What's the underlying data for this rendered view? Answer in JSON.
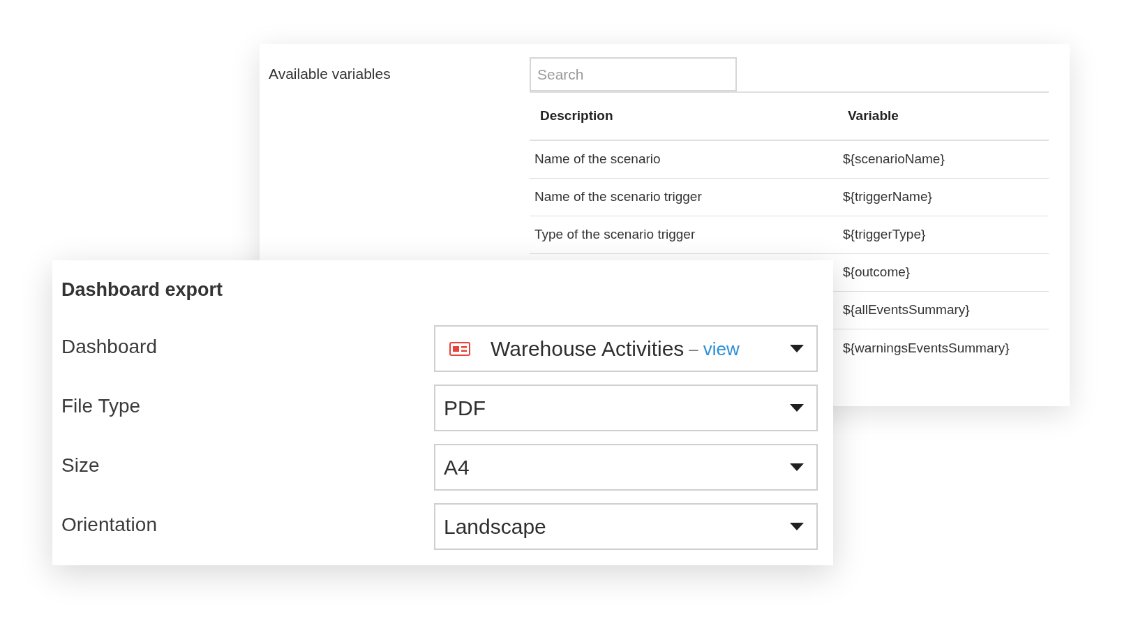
{
  "variables_panel": {
    "title": "Available variables",
    "search": {
      "placeholder": "Search"
    },
    "table": {
      "columns": [
        "Description",
        "Variable"
      ],
      "rows": [
        {
          "description": "Name of the scenario",
          "variable": "${scenarioName}"
        },
        {
          "description": "Name of the scenario trigger",
          "variable": "${triggerName}"
        },
        {
          "description": "Type of the scenario trigger",
          "variable": "${triggerType}"
        },
        {
          "variable": "${outcome}"
        },
        {
          "variable": "${allEventsSummary}"
        },
        {
          "variable": "${warningsEventsSummary}"
        }
      ]
    }
  },
  "dashboard_export": {
    "title": "Dashboard export",
    "fields": [
      {
        "kind": "dashboard",
        "label": "Dashboard",
        "value": "Warehouse Activities",
        "separator": "–",
        "link": "view"
      },
      {
        "kind": "select",
        "label": "File Type",
        "value": "PDF"
      },
      {
        "kind": "select",
        "label": "Size",
        "value": "A4"
      },
      {
        "kind": "select",
        "label": "Orientation",
        "value": "Landscape"
      }
    ]
  }
}
